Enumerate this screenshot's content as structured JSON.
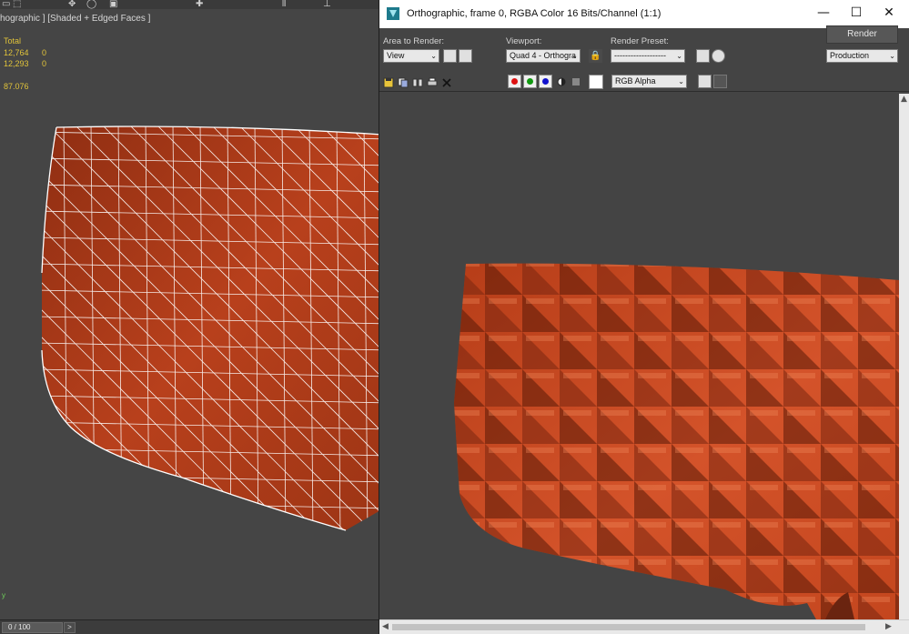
{
  "viewport": {
    "label": "hographic ] [Shaded + Edged Faces ]",
    "stats": {
      "header": "Total",
      "rows": [
        {
          "a": "12,764",
          "b": "0"
        },
        {
          "a": "12,293",
          "b": "0"
        }
      ],
      "fps": "87.076"
    },
    "axis_label": "y",
    "timeline": {
      "frame": "0 / 100",
      "next": ">"
    }
  },
  "window": {
    "title": "Orthographic, frame 0, RGBA Color 16 Bits/Channel (1:1)",
    "controls": {
      "minimize": "—",
      "maximize": "☐",
      "close": "✕"
    },
    "area_to_render": {
      "label": "Area to Render:",
      "value": "View"
    },
    "viewport": {
      "label": "Viewport:",
      "value": "Quad 4 - Orthogra"
    },
    "render_preset": {
      "label": "Render Preset:",
      "value": "-------------------"
    },
    "render_button": "Render",
    "production": "Production",
    "channel": "RGB Alpha"
  },
  "colors": {
    "mesh_fill": "#b8401c",
    "mesh_edge": "#ffffff",
    "render_fill": "#c9471d",
    "stats_text": "#e0c33a"
  }
}
